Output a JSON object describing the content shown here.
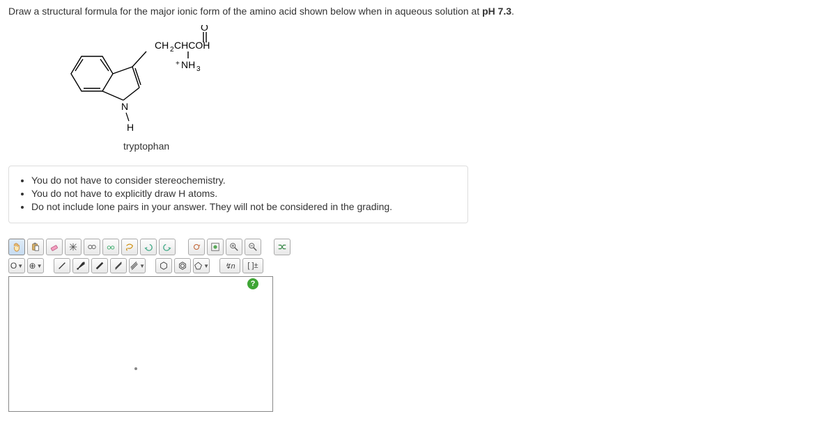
{
  "question": {
    "prefix": "Draw a structural formula for the major ionic form of the amino acid shown below when in aqueous solution at ",
    "bold_part": "pH 7.3",
    "suffix": "."
  },
  "structure": {
    "name": "tryptophan",
    "labels": {
      "top_O": "O",
      "chain": "CH₂CHCOH",
      "nh3_plus": "⁺NH₃",
      "ring_N": "N",
      "ring_H": "H"
    }
  },
  "instructions": [
    "You do not have to consider stereochemistry.",
    "You do not have to explicitly draw H atoms.",
    "Do not include lone pairs in your answer. They will not be considered in the grading."
  ],
  "toolbar1": {
    "icons": [
      "hand",
      "paste",
      "eraser",
      "snowflake",
      "goggles",
      "glasses",
      "lasso",
      "undo",
      "redo",
      "rotate",
      "view",
      "zoom-in",
      "zoom-out",
      "shuffle"
    ]
  },
  "toolbar2": {
    "element_label": "O",
    "add_label": "⊕",
    "bond_icons": [
      "single",
      "wedge",
      "dash",
      "double",
      "triple"
    ],
    "ring_icons": [
      "cyclohexane",
      "benzene",
      "cyclopentane"
    ],
    "chain_label": "↯n",
    "charge_label": "[ ]±"
  },
  "help": "?"
}
